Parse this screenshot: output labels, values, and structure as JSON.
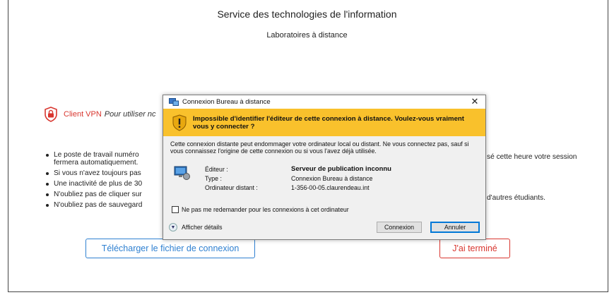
{
  "page": {
    "title": "Service des technologies de l'information",
    "subtitle": "Laboratoires à distance",
    "vpn_label": "Client VPN",
    "vpn_text": "Pour utiliser nc",
    "notes": [
      "Le poste de travail numéro",
      "fermera automatiquement.",
      "Si vous n'avez toujours pas",
      "Une inactivité de plus de 30",
      "N'oubliez pas de cliquer sur",
      "N'oubliez pas de sauvegard"
    ],
    "notes_right_1": "sé cette heure votre session",
    "notes_right_2": "d'autres étudiants.",
    "download_button": "Télécharger le fichier de connexion",
    "done_button": "J'ai terminé",
    "colors": {
      "red": "#d8362f",
      "blue": "#2f80d1"
    }
  },
  "dialog": {
    "title": "Connexion Bureau à distance",
    "close": "✕",
    "warning": "Impossible d'identifier l'éditeur de cette connexion à distance. Voulez-vous vraiment vous y connecter ?",
    "message": "Cette connexion distante peut endommager votre ordinateur local ou distant. Ne vous connectez pas, sauf si vous connaissez l'origine de cette connexion ou si vous l'avez déjà utilisée.",
    "fields": [
      {
        "label": "Éditeur :",
        "value": "Serveur de publication inconnu"
      },
      {
        "label": "Type :",
        "value": "Connexion Bureau à distance"
      },
      {
        "label": "Ordinateur distant :",
        "value": "1-356-00-05.claurendeau.int"
      }
    ],
    "checkbox_label": "Ne pas me redemander pour les connexions à cet ordinateur",
    "details_label": "Afficher détails",
    "connect_button": "Connexion",
    "cancel_button": "Annuler",
    "colors": {
      "warning_band": "#f9c12c",
      "focus": "#0078d7"
    }
  }
}
